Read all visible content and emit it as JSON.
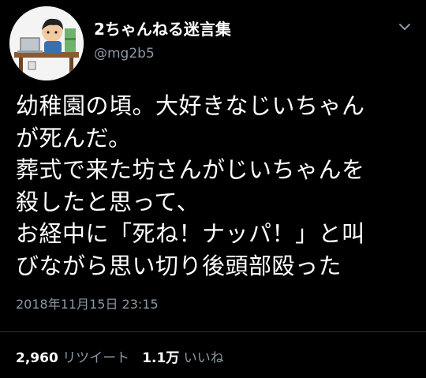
{
  "tweet": {
    "account_name": "2ちゃんねる迷言集",
    "handle": "@mg2b5",
    "text_lines": [
      "幼稚園の頃。大好きなじいちゃん",
      "が死んだ。",
      "葬式で来た坊さんがじいちゃんを",
      "殺したと思って、",
      "お経中に「死ね！ナッパ！」と叫",
      "びながら思い切り後頭部殴った"
    ],
    "timestamp": "2018年11月15日 23:15",
    "retweet_count": "2,960",
    "retweet_label": "リツイート",
    "like_count": "1.1万",
    "like_label": "いいね"
  },
  "icons": {
    "menu": "chevron-down-icon",
    "avatar": "avatar-illustration"
  },
  "colors": {
    "background": "#000000",
    "text": "#ffffff",
    "secondary": "#8b98a5"
  }
}
